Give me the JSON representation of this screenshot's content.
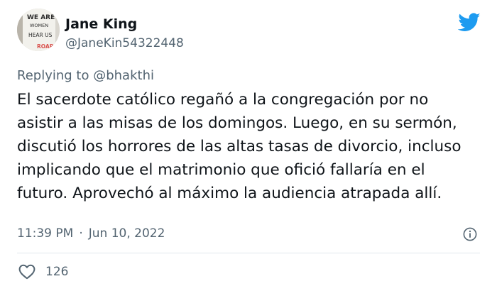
{
  "user": {
    "display_name": "Jane King",
    "handle": "@JaneKin54322448",
    "avatar_sign_lines": [
      "WE ARE",
      "WOMEN",
      "HEAR US",
      "ROAR"
    ]
  },
  "reply": {
    "prefix": "Replying to",
    "mention": "@bhakthi"
  },
  "tweet": {
    "text": "El sacerdote católico regañó a la congregación por no asistir a las misas de los domingos. Luego, en su sermón, discutió los horrores de las altas tasas de divorcio, incluso implicando que el matrimonio que ofició fallaría en el futuro. Aprovechó al máximo la audiencia atrapada allí.",
    "time": "11:39 PM",
    "separator": "·",
    "date": "Jun 10, 2022"
  },
  "engagement": {
    "likes": "126"
  },
  "icons": {
    "brand": "twitter-bird-icon",
    "info": "info-icon",
    "like": "heart-icon"
  },
  "colors": {
    "twitter_blue": "#1d9bf0",
    "text_primary": "#0f1419",
    "text_secondary": "#536471",
    "divider": "#e1e8ed"
  }
}
